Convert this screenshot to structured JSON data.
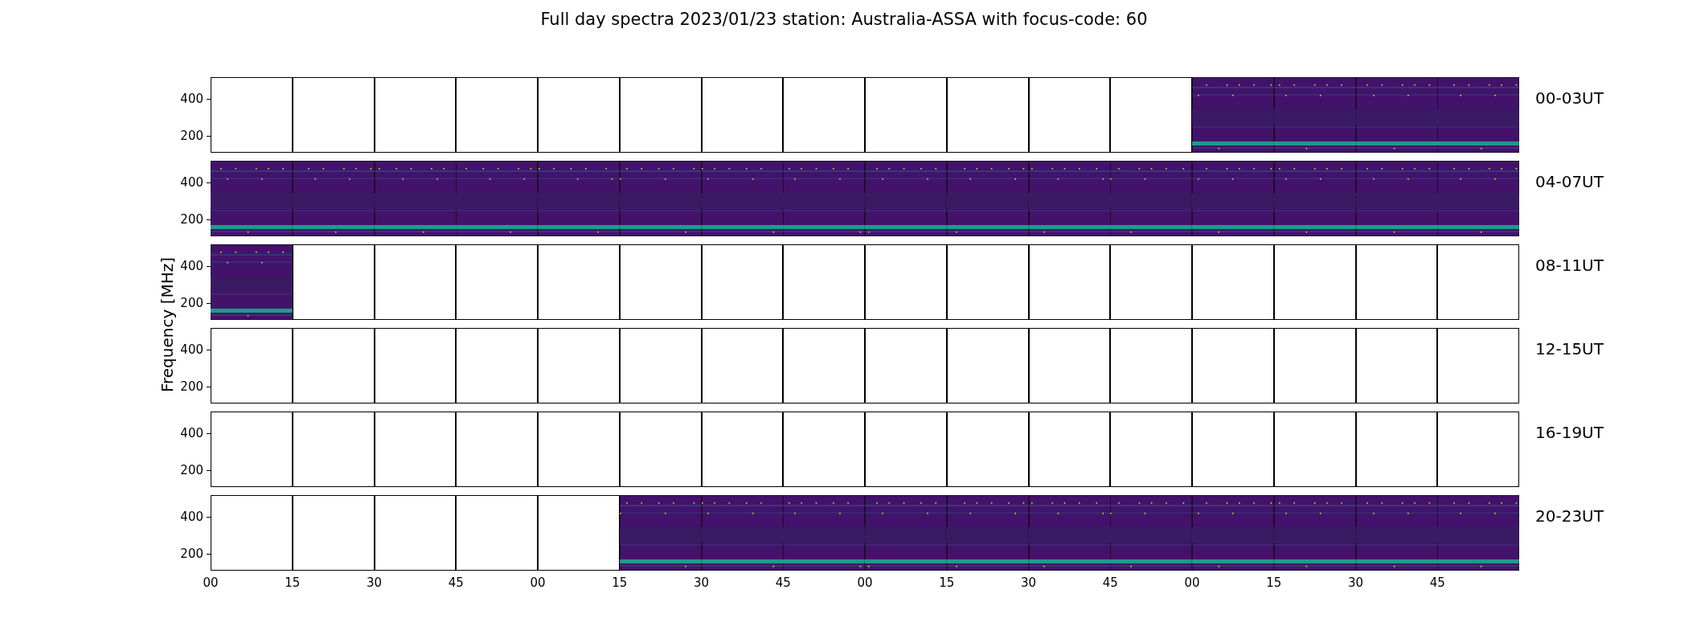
{
  "title": "Full day spectra 2023/01/23 station: Australia-ASSA with focus-code: 60",
  "ylabel": "Frequency [MHz]",
  "rows": [
    {
      "label": "00-03UT",
      "yticks": [
        "400",
        "200"
      ],
      "panels": [
        {
          "has_data": false
        },
        {
          "has_data": false
        },
        {
          "has_data": false
        },
        {
          "has_data": false
        },
        {
          "has_data": false
        },
        {
          "has_data": false
        },
        {
          "has_data": false
        },
        {
          "has_data": false
        },
        {
          "has_data": false
        },
        {
          "has_data": false
        },
        {
          "has_data": false
        },
        {
          "has_data": false
        },
        {
          "has_data": true
        },
        {
          "has_data": true
        },
        {
          "has_data": true
        },
        {
          "has_data": true
        }
      ]
    },
    {
      "label": "04-07UT",
      "yticks": [
        "400",
        "200"
      ],
      "panels": [
        {
          "has_data": true
        },
        {
          "has_data": true
        },
        {
          "has_data": true
        },
        {
          "has_data": true
        },
        {
          "has_data": true
        },
        {
          "has_data": true
        },
        {
          "has_data": true
        },
        {
          "has_data": true
        },
        {
          "has_data": true
        },
        {
          "has_data": true
        },
        {
          "has_data": true
        },
        {
          "has_data": true
        },
        {
          "has_data": true
        },
        {
          "has_data": true
        },
        {
          "has_data": true
        },
        {
          "has_data": true
        }
      ]
    },
    {
      "label": "08-11UT",
      "yticks": [
        "400",
        "200"
      ],
      "panels": [
        {
          "has_data": true
        },
        {
          "has_data": false
        },
        {
          "has_data": false
        },
        {
          "has_data": false
        },
        {
          "has_data": false
        },
        {
          "has_data": false
        },
        {
          "has_data": false
        },
        {
          "has_data": false
        },
        {
          "has_data": false
        },
        {
          "has_data": false
        },
        {
          "has_data": false
        },
        {
          "has_data": false
        },
        {
          "has_data": false
        },
        {
          "has_data": false
        },
        {
          "has_data": false
        },
        {
          "has_data": false
        }
      ]
    },
    {
      "label": "12-15UT",
      "yticks": [
        "400",
        "200"
      ],
      "panels": [
        {
          "has_data": false
        },
        {
          "has_data": false
        },
        {
          "has_data": false
        },
        {
          "has_data": false
        },
        {
          "has_data": false
        },
        {
          "has_data": false
        },
        {
          "has_data": false
        },
        {
          "has_data": false
        },
        {
          "has_data": false
        },
        {
          "has_data": false
        },
        {
          "has_data": false
        },
        {
          "has_data": false
        },
        {
          "has_data": false
        },
        {
          "has_data": false
        },
        {
          "has_data": false
        },
        {
          "has_data": false
        }
      ]
    },
    {
      "label": "16-19UT",
      "yticks": [
        "400",
        "200"
      ],
      "panels": [
        {
          "has_data": false
        },
        {
          "has_data": false
        },
        {
          "has_data": false
        },
        {
          "has_data": false
        },
        {
          "has_data": false
        },
        {
          "has_data": false
        },
        {
          "has_data": false
        },
        {
          "has_data": false
        },
        {
          "has_data": false
        },
        {
          "has_data": false
        },
        {
          "has_data": false
        },
        {
          "has_data": false
        },
        {
          "has_data": false
        },
        {
          "has_data": false
        },
        {
          "has_data": false
        },
        {
          "has_data": false
        }
      ]
    },
    {
      "label": "20-23UT",
      "yticks": [
        "400",
        "200"
      ],
      "panels": [
        {
          "has_data": false
        },
        {
          "has_data": false
        },
        {
          "has_data": false
        },
        {
          "has_data": false
        },
        {
          "has_data": false
        },
        {
          "has_data": true
        },
        {
          "has_data": true
        },
        {
          "has_data": true
        },
        {
          "has_data": true
        },
        {
          "has_data": true
        },
        {
          "has_data": true
        },
        {
          "has_data": true
        },
        {
          "has_data": true
        },
        {
          "has_data": true
        },
        {
          "has_data": true
        },
        {
          "has_data": true
        }
      ]
    }
  ],
  "xticks": [
    "00",
    "15",
    "30",
    "45",
    "00",
    "15",
    "30",
    "45",
    "00",
    "15",
    "30",
    "45",
    "00",
    "15",
    "30",
    "45"
  ]
}
